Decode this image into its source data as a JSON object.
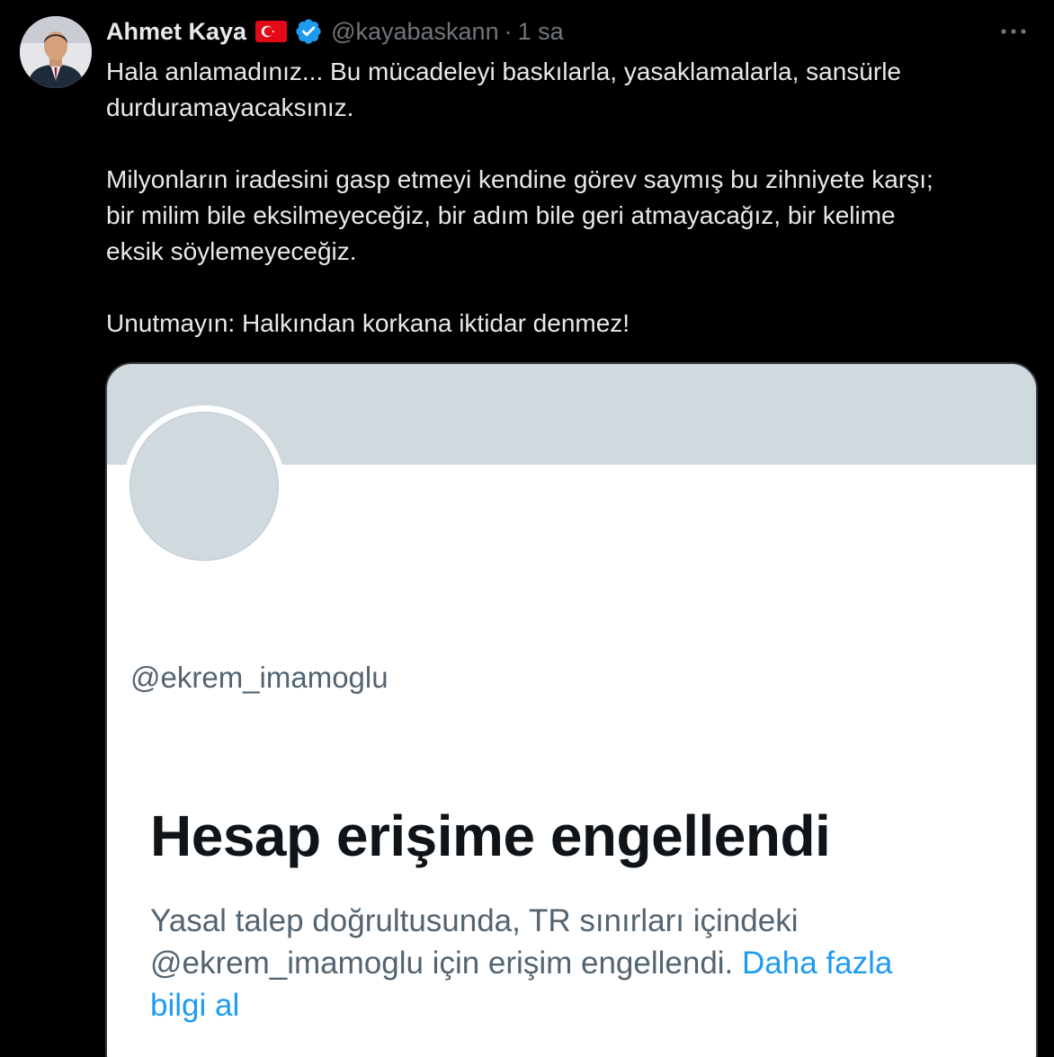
{
  "tweet": {
    "author": {
      "display_name": "Ahmet Kaya",
      "handle": "@kayabaskann",
      "avatar": "person-avatar-icon",
      "badges": [
        "turkey-flag-icon",
        "verified-badge-icon"
      ]
    },
    "separator": "·",
    "time": "1 sa",
    "more_icon": "more-horizontal-icon",
    "text_lines": [
      "Hala anlamadınız... Bu mücadeleyi baskılarla, yasaklamalarla, sansürle",
      "durduramayacaksınız.",
      "Milyonların iradesini gasp etmeyi kendine görev saymış bu zihniyete karşı;",
      "bir milim bile eksilmeyeceğiz, bir adım bile geri atmayacağız, bir kelime",
      "eksik söylemeyeceğiz.",
      "Unutmayın: Halkından korkana iktidar denmez!"
    ]
  },
  "media_card": {
    "handle": "@ekrem_imamoglu",
    "title": "Hesap erişime engellendi",
    "desc_line1": "Yasal talep doğrultusunda, TR sınırları içindeki",
    "desc_line2_text": "@ekrem_imamoglu için erişim engellendi. ",
    "desc_line2_link": "Daha fazla",
    "desc_line3_link": "bilgi al"
  },
  "colors": {
    "background": "#000000",
    "text_primary": "#e7e9ea",
    "text_secondary": "#71767b",
    "verified_blue": "#1d9bf0",
    "card_banner": "#cfd9de",
    "card_title": "#0f1419",
    "card_secondary": "#536471",
    "link": "#1d9bf0"
  }
}
